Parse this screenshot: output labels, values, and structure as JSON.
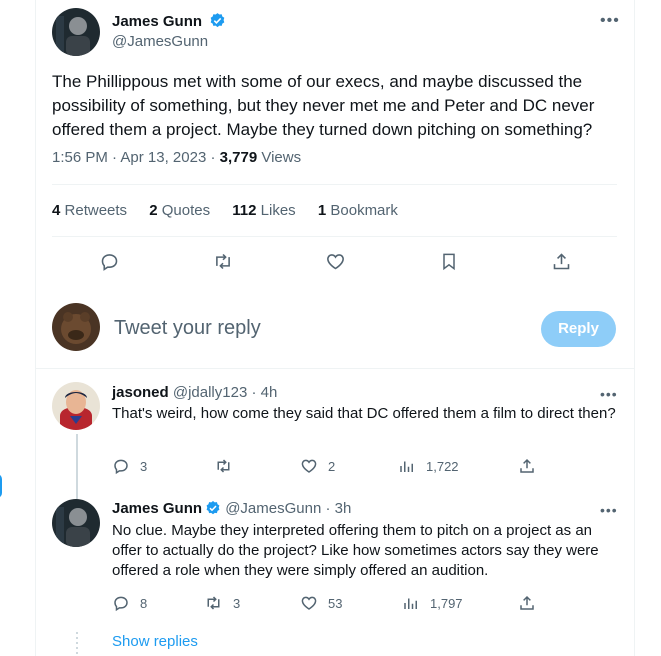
{
  "tweet": {
    "author_name": "James Gunn",
    "author_handle": "@JamesGunn",
    "text": "The Phillippous met with some of our execs, and maybe discussed the possibility of something, but they never met me and Peter and DC never offered them a project. Maybe they turned down pitching on something?",
    "time": "1:56 PM",
    "date": "Apr 13, 2023",
    "views_count": "3,779",
    "views_label": "Views",
    "retweets_count": "4",
    "retweets_label": "Retweets",
    "quotes_count": "2",
    "quotes_label": "Quotes",
    "likes_count": "112",
    "likes_label": "Likes",
    "bookmarks_count": "1",
    "bookmarks_label": "Bookmark"
  },
  "compose": {
    "placeholder": "Tweet your reply",
    "reply_button": "Reply"
  },
  "replies": [
    {
      "author_name": "jasoned",
      "author_handle": "@jdally123",
      "age": "4h",
      "text": "That's weird, how come they said that DC offered them a film to direct then?",
      "replies": "3",
      "retweets": "",
      "likes": "2",
      "views": "1,722"
    },
    {
      "author_name": "James Gunn",
      "author_handle": "@JamesGunn",
      "age": "3h",
      "text": "No clue. Maybe they interpreted offering them to pitch on a project as an offer to actually do the project? Like how sometimes actors say they were offered a role when they were simply offered an audition.",
      "replies": "8",
      "retweets": "3",
      "likes": "53",
      "views": "1,797"
    }
  ],
  "show_replies": "Show replies",
  "colors": {
    "accent": "#1d9bf0",
    "text": "#0f1419",
    "muted": "#536471",
    "reply_button_bg": "#8ecdf8"
  }
}
